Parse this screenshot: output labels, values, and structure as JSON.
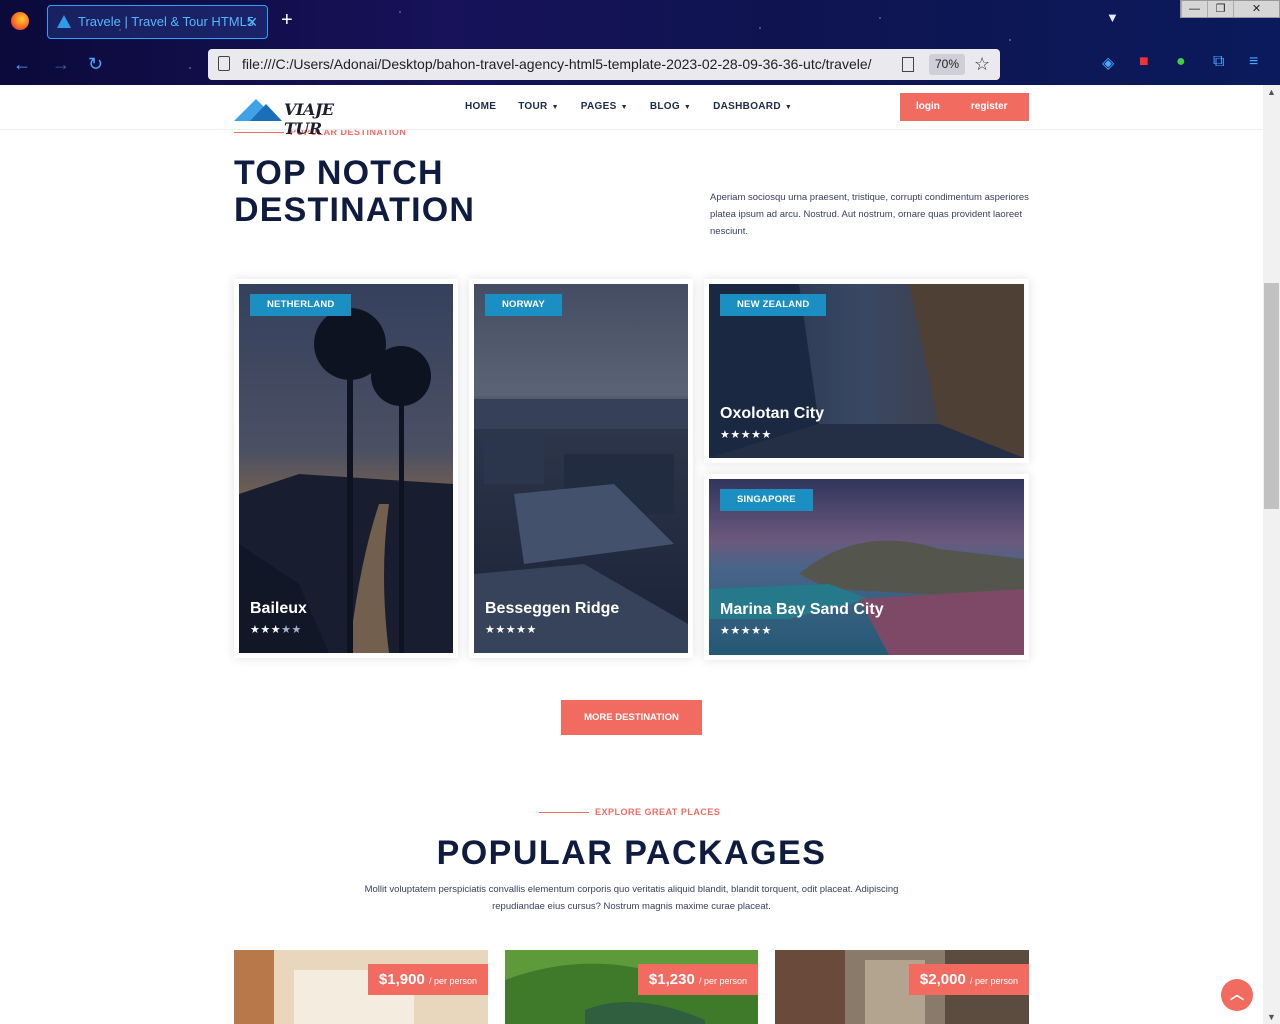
{
  "browser": {
    "tab_title": "Travele | Travel & Tour HTML5",
    "url": "file:///C:/Users/Adonai/Desktop/bahon-travel-agency-html5-template-2023-02-28-09-36-36-utc/travele/",
    "zoom": "70%"
  },
  "site": {
    "logo_text": "VIAJE TUR",
    "nav": [
      "HOME",
      "TOUR",
      "PAGES",
      "BLOG",
      "DASHBOARD"
    ],
    "login": "login",
    "register": "register"
  },
  "destinations": {
    "kicker": "POPULAR DESTINATION",
    "heading": "TOP NOTCH DESTINATION",
    "intro": "Aperiam sociosqu urna praesent, tristique, corrupti condimentum asperiores platea ipsum ad arcu. Nostrud. Aut nostrum, ornare quas provident laoreet nesciunt.",
    "cards": [
      {
        "country": "NETHERLAND",
        "name": "Baileux",
        "rating": 3.5
      },
      {
        "country": "NORWAY",
        "name": "Besseggen Ridge",
        "rating": 5
      },
      {
        "country": "NEW ZEALAND",
        "name": "Oxolotan City",
        "rating": 5
      },
      {
        "country": "SINGAPORE",
        "name": "Marina Bay Sand City",
        "rating": 5
      }
    ],
    "more_button": "MORE DESTINATION"
  },
  "packages": {
    "kicker": "EXPLORE GREAT PLACES",
    "heading": "POPULAR PACKAGES",
    "intro": "Mollit voluptatem perspiciatis convallis elementum corporis quo veritatis aliquid blandit, blandit torquent, odit placeat. Adipiscing repudiandae eius cursus? Nostrum magnis maxime curae placeat.",
    "items": [
      {
        "price": "$1,900",
        "unit": "/ per person"
      },
      {
        "price": "$1,230",
        "unit": "/ per person"
      },
      {
        "price": "$2,000",
        "unit": "/ per person"
      }
    ]
  },
  "icons": [
    "firefox-icon",
    "back-icon",
    "forward-icon",
    "reload-icon",
    "page-icon",
    "reader-icon",
    "bookmark-star-icon",
    "pocket-icon",
    "extension-icon",
    "puzzle-icon",
    "menu-icon",
    "scroll-top-icon"
  ],
  "colors": {
    "accent": "#f26b61",
    "navy": "#0f1c3f",
    "badge": "#1b8ec2"
  }
}
